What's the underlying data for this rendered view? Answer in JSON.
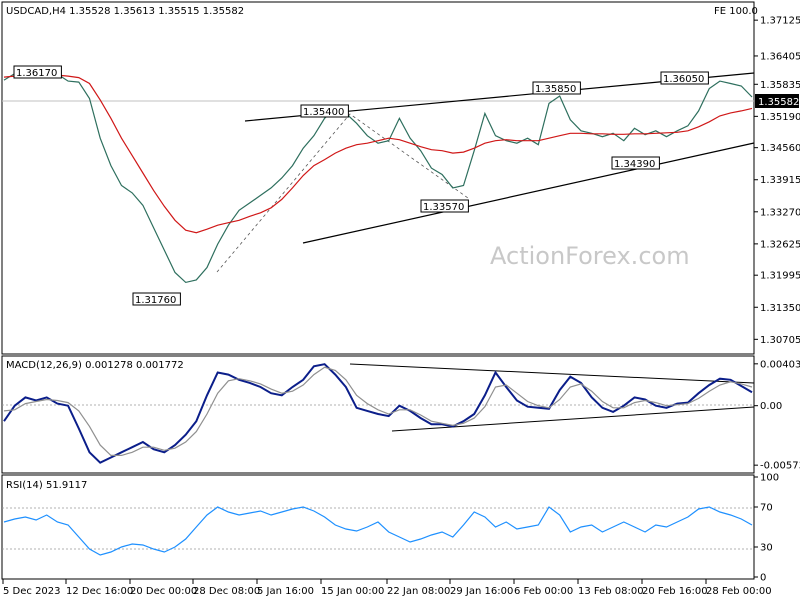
{
  "chart_data": [
    {
      "type": "line",
      "panel": "price",
      "symbol_header": "USDCAD,H4  1.35528  1.35613  1.35515  1.35582",
      "fe_label": "FE 100.0",
      "watermark": "ActionForex.com",
      "last_price": "1.35582",
      "x_ticks": [
        "5 Dec 2023",
        "12 Dec 16:00",
        "20 Dec 00:00",
        "28 Dec 08:00",
        "5 Jan 16:00",
        "15 Jan 00:00",
        "22 Jan 08:00",
        "29 Jan 16:00",
        "6 Feb 00:00",
        "13 Feb 08:00",
        "20 Feb 16:00",
        "28 Feb 00:00"
      ],
      "y_ticks": [
        "1.37125",
        "1.36405",
        "1.35835",
        "1.35190",
        "1.34560",
        "1.33915",
        "1.33270",
        "1.32625",
        "1.31995",
        "1.31350",
        "1.30705"
      ],
      "ylim": [
        1.3045,
        1.3745
      ],
      "annotations": [
        "1.36170",
        "1.35400",
        "1.35850",
        "1.36050",
        "1.34390",
        "1.33570",
        "1.31760"
      ],
      "series": [
        {
          "name": "",
          "color": "#2e6f5e",
          "x": [
            0,
            4,
            8,
            12,
            16,
            20,
            24,
            28,
            32,
            36,
            40,
            44,
            48,
            52,
            56,
            60,
            64,
            68,
            72,
            76,
            80,
            84,
            88,
            92,
            96,
            100,
            104,
            108,
            112,
            116,
            120,
            124,
            128,
            132,
            136,
            140,
            144,
            148,
            152,
            156,
            160,
            164,
            168,
            172,
            176,
            180,
            184,
            188,
            192,
            196,
            200,
            204,
            208,
            212,
            216,
            220,
            224,
            228,
            232,
            236,
            240,
            244,
            248,
            252,
            256,
            260,
            264,
            268,
            272,
            276,
            280
          ],
          "values": [
            1.3592,
            1.3605,
            1.36,
            1.3612,
            1.3598,
            1.3604,
            1.359,
            1.3588,
            1.3555,
            1.3475,
            1.342,
            1.338,
            1.3365,
            1.334,
            1.3295,
            1.325,
            1.3205,
            1.3185,
            1.319,
            1.3215,
            1.3262,
            1.33,
            1.333,
            1.3345,
            1.336,
            1.3375,
            1.3395,
            1.342,
            1.3455,
            1.348,
            1.3515,
            1.3535,
            1.3525,
            1.3505,
            1.348,
            1.3465,
            1.347,
            1.3515,
            1.3475,
            1.345,
            1.3415,
            1.3402,
            1.3375,
            1.338,
            1.345,
            1.3525,
            1.348,
            1.347,
            1.3465,
            1.3475,
            1.3462,
            1.3545,
            1.356,
            1.3512,
            1.349,
            1.3485,
            1.3478,
            1.3485,
            1.347,
            1.3495,
            1.3482,
            1.349,
            1.3478,
            1.349,
            1.35,
            1.353,
            1.3575,
            1.359,
            1.3585,
            1.358,
            1.3558
          ]
        },
        {
          "name": "",
          "color": "#d01818",
          "x": [
            0,
            4,
            8,
            12,
            16,
            20,
            24,
            28,
            32,
            36,
            40,
            44,
            48,
            52,
            56,
            60,
            64,
            68,
            72,
            76,
            80,
            84,
            88,
            92,
            96,
            100,
            104,
            108,
            112,
            116,
            120,
            124,
            128,
            132,
            136,
            140,
            144,
            148,
            152,
            156,
            160,
            164,
            168,
            172,
            176,
            180,
            184,
            188,
            192,
            196,
            200,
            204,
            208,
            212,
            216,
            220,
            224,
            228,
            232,
            236,
            240,
            244,
            248,
            252,
            256,
            260,
            264,
            268,
            272,
            276,
            280
          ],
          "values": [
            1.3598,
            1.36,
            1.3602,
            1.3603,
            1.3603,
            1.3602,
            1.36,
            1.3597,
            1.3585,
            1.3552,
            1.3515,
            1.3475,
            1.344,
            1.3405,
            1.337,
            1.3338,
            1.331,
            1.329,
            1.3285,
            1.3292,
            1.33,
            1.3305,
            1.331,
            1.3318,
            1.3325,
            1.3335,
            1.3352,
            1.3375,
            1.34,
            1.342,
            1.3432,
            1.3445,
            1.3455,
            1.3462,
            1.3465,
            1.347,
            1.3475,
            1.3472,
            1.3465,
            1.3458,
            1.3452,
            1.345,
            1.3445,
            1.3447,
            1.3455,
            1.3465,
            1.347,
            1.3472,
            1.347,
            1.347,
            1.347,
            1.3475,
            1.348,
            1.3485,
            1.3485,
            1.3484,
            1.3484,
            1.3483,
            1.3483,
            1.3484,
            1.3484,
            1.3485,
            1.3486,
            1.3487,
            1.349,
            1.3498,
            1.3508,
            1.352,
            1.3526,
            1.353,
            1.3535
          ]
        }
      ]
    },
    {
      "type": "line",
      "panel": "macd",
      "title": "MACD(12,26,9) 0.001278 0.001772",
      "y_ticks": [
        "0.004038",
        "0.00",
        "-0.005737"
      ],
      "ylim": [
        -0.0063,
        0.0046
      ],
      "series": [
        {
          "name": "",
          "color": "#0b1e8a",
          "x": [
            0,
            4,
            8,
            12,
            16,
            20,
            24,
            28,
            32,
            36,
            40,
            44,
            48,
            52,
            56,
            60,
            64,
            68,
            72,
            76,
            80,
            84,
            88,
            92,
            96,
            100,
            104,
            108,
            112,
            116,
            120,
            124,
            128,
            132,
            136,
            140,
            144,
            148,
            152,
            156,
            160,
            164,
            168,
            172,
            176,
            180,
            184,
            188,
            192,
            196,
            200,
            204,
            208,
            212,
            216,
            220,
            224,
            228,
            232,
            236,
            240,
            244,
            248,
            252,
            256,
            260,
            264,
            268,
            272,
            276,
            280
          ],
          "values": [
            -0.0015,
            0.0,
            0.0008,
            0.0005,
            0.0008,
            0.0002,
            0.0,
            -0.0022,
            -0.0045,
            -0.0055,
            -0.005,
            -0.0045,
            -0.004,
            -0.0035,
            -0.0042,
            -0.0045,
            -0.0038,
            -0.0028,
            -0.0015,
            0.001,
            0.0032,
            0.003,
            0.0025,
            0.0022,
            0.0018,
            0.0012,
            0.001,
            0.0018,
            0.0025,
            0.0038,
            0.004,
            0.003,
            0.0018,
            -0.0002,
            -0.0005,
            -0.0008,
            -0.001,
            0.0,
            -0.0005,
            -0.0012,
            -0.0018,
            -0.0018,
            -0.002,
            -0.0015,
            -0.0008,
            0.001,
            0.0032,
            0.0018,
            0.0005,
            -0.0001,
            -0.0002,
            -0.0003,
            0.0015,
            0.0028,
            0.0022,
            0.0008,
            -0.0002,
            -0.0006,
            0.0,
            0.0008,
            0.0006,
            0.0,
            -0.0002,
            0.0002,
            0.0003,
            0.0012,
            0.002,
            0.0026,
            0.0025,
            0.0019,
            0.0013
          ]
        },
        {
          "name": "",
          "color": "#909090",
          "x": [
            0,
            4,
            8,
            12,
            16,
            20,
            24,
            28,
            32,
            36,
            40,
            44,
            48,
            52,
            56,
            60,
            64,
            68,
            72,
            76,
            80,
            84,
            88,
            92,
            96,
            100,
            104,
            108,
            112,
            116,
            120,
            124,
            128,
            132,
            136,
            140,
            144,
            148,
            152,
            156,
            160,
            164,
            168,
            172,
            176,
            180,
            184,
            188,
            192,
            196,
            200,
            204,
            208,
            212,
            216,
            220,
            224,
            228,
            232,
            236,
            240,
            244,
            248,
            252,
            256,
            260,
            264,
            268,
            272,
            276,
            280
          ],
          "values": [
            -0.0005,
            -0.0004,
            0.0002,
            0.0004,
            0.0006,
            0.0005,
            0.0003,
            -0.0005,
            -0.002,
            -0.0038,
            -0.0048,
            -0.0048,
            -0.0045,
            -0.004,
            -0.004,
            -0.0043,
            -0.0041,
            -0.0035,
            -0.0025,
            -0.0008,
            0.0012,
            0.0024,
            0.0026,
            0.0024,
            0.0021,
            0.0016,
            0.0012,
            0.0014,
            0.002,
            0.003,
            0.0037,
            0.0034,
            0.0025,
            0.001,
            0.0002,
            -0.0004,
            -0.0008,
            -0.0004,
            -0.0004,
            -0.0009,
            -0.0015,
            -0.0017,
            -0.0019,
            -0.0017,
            -0.0012,
            -0.0001,
            0.0018,
            0.002,
            0.0012,
            0.0004,
            0.0,
            -0.0002,
            0.0006,
            0.0018,
            0.0021,
            0.0014,
            0.0004,
            -0.0002,
            -0.0002,
            0.0003,
            0.0005,
            0.0003,
            0.0,
            0.0001,
            0.0002,
            0.0007,
            0.0014,
            0.002,
            0.0023,
            0.0021,
            0.0018
          ]
        }
      ]
    },
    {
      "type": "line",
      "panel": "rsi",
      "title": "RSI(14) 51.9117",
      "y_ticks": [
        "100",
        "70",
        "30",
        "0"
      ],
      "ylim": [
        0,
        100
      ],
      "series": [
        {
          "name": "",
          "color": "#1e90ff",
          "x": [
            0,
            4,
            8,
            12,
            16,
            20,
            24,
            28,
            32,
            36,
            40,
            44,
            48,
            52,
            56,
            60,
            64,
            68,
            72,
            76,
            80,
            84,
            88,
            92,
            96,
            100,
            104,
            108,
            112,
            116,
            120,
            124,
            128,
            132,
            136,
            140,
            144,
            148,
            152,
            156,
            160,
            164,
            168,
            172,
            176,
            180,
            184,
            188,
            192,
            196,
            200,
            204,
            208,
            212,
            216,
            220,
            224,
            228,
            232,
            236,
            240,
            244,
            248,
            252,
            256,
            260,
            264,
            268,
            272,
            276,
            280
          ],
          "values": [
            55,
            58,
            60,
            57,
            62,
            55,
            52,
            40,
            28,
            22,
            25,
            30,
            33,
            32,
            28,
            25,
            30,
            38,
            50,
            62,
            70,
            65,
            62,
            64,
            66,
            62,
            65,
            68,
            70,
            66,
            60,
            52,
            48,
            46,
            50,
            55,
            45,
            40,
            35,
            38,
            42,
            45,
            40,
            52,
            65,
            60,
            50,
            55,
            48,
            50,
            52,
            70,
            62,
            45,
            50,
            52,
            45,
            50,
            55,
            50,
            45,
            52,
            50,
            55,
            60,
            68,
            70,
            65,
            62,
            58,
            52
          ]
        }
      ]
    }
  ]
}
